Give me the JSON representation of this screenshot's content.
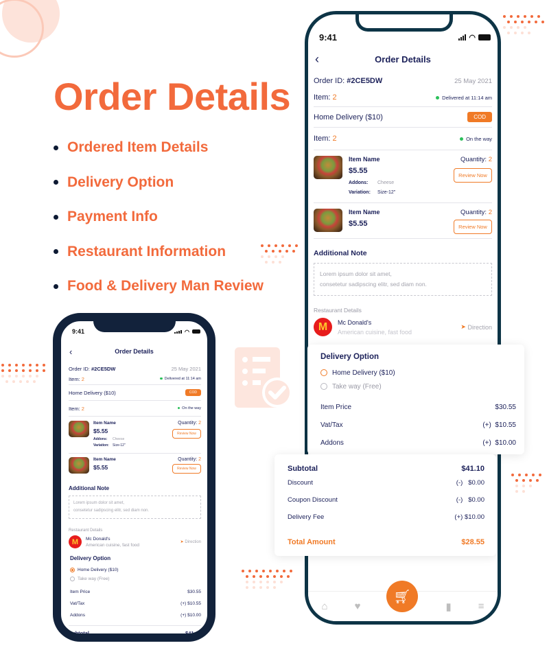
{
  "hero": {
    "title": "Order Details",
    "features": [
      "Ordered Item Details",
      "Delivery Option",
      "Payment Info",
      "Restaurant Information",
      "Food & Delivery Man Review"
    ]
  },
  "colors": {
    "accent": "#f26a3c",
    "button_orange": "#f07a26",
    "navy": "#1b2059",
    "frame_dark": "#0d3446",
    "success_green": "#2bc05a"
  },
  "phone": {
    "status_time": "9:41",
    "header_title": "Order Details",
    "back_icon": "chevron-left-icon",
    "order": {
      "id_label": "Order ID:",
      "id_value": "#2CE5DW",
      "date": "25 May 2021",
      "item_label": "Item:",
      "item_count": "2",
      "delivered_status": "Delivered at 11:14 am",
      "delivery_type": "Home Delivery ($10)",
      "payment_badge": "COD",
      "item_count_2": "2",
      "on_the_way_status": "On the way"
    },
    "items": [
      {
        "name": "Item Name",
        "price": "$5.55",
        "quantity_label": "Quantity:",
        "quantity": "2",
        "review_label": "Review Now",
        "addons_label": "Addons:",
        "addons_value": "Cheese",
        "variation_label": "Variation:",
        "variation_value": "Size-12\""
      },
      {
        "name": "Item Name",
        "price": "$5.55",
        "quantity_label": "Quantity:",
        "quantity": "2",
        "review_label": "Review Now"
      }
    ],
    "note": {
      "title": "Additional Note",
      "line1": "Lorem ipsum dolor sit amet,",
      "line2": "consetetur sadipscing elitr, sed diam non."
    },
    "restaurant": {
      "section_label": "Restaurant Details",
      "name": "Mc Donald's",
      "cuisine": "American cuisine, fast food",
      "direction_label": "Direction",
      "logo_glyph": "M"
    },
    "delivery_option": {
      "title": "Delivery Option",
      "options": [
        {
          "label": "Home Delivery ($10)",
          "selected": true
        },
        {
          "label": "Take way (Free)",
          "selected": false
        }
      ]
    },
    "pricing": {
      "item_price_label": "Item Price",
      "item_price": "$30.55",
      "vat_label": "Vat/Tax",
      "vat_sign": "(+)",
      "vat": "$10.55",
      "addons_label": "Addons",
      "addons_sign": "(+)",
      "addons": "$10.00"
    },
    "totals": {
      "subtotal_label": "Subtotal",
      "subtotal": "$41.10",
      "discount_label": "Discount",
      "discount_sign": "(-)",
      "discount": "$0.00",
      "coupon_label": "Coupon Discount",
      "coupon_sign": "(-)",
      "coupon": "$0.00",
      "delivery_fee_label": "Delivery Fee",
      "delivery_fee_sign": "(+)",
      "delivery_fee": "$10.00",
      "total_label": "Total Amount",
      "total": "$28.55"
    },
    "bottom_nav": [
      "home-icon",
      "heart-icon",
      "cart-icon",
      "bookmark-icon",
      "menu-icon"
    ]
  }
}
